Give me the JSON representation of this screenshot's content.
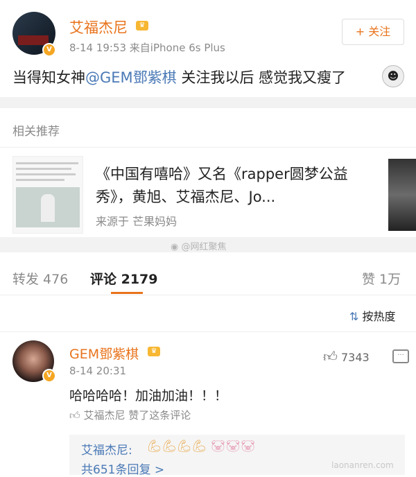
{
  "post": {
    "author": "艾福杰尼",
    "meta": "8-14 19:53  来自iPhone 6s Plus",
    "follow_label": "+ 关注",
    "text_prefix": "当得知女神",
    "mention": "@GEM鄧紫棋",
    "text_suffix": " 关注我以后 感觉我又瘦了"
  },
  "related": {
    "section_title": "相关推荐",
    "card_title": "《中国有嘻哈》又名《rapper圆梦公益秀》，黄旭、艾福杰尼、Jo...",
    "card_source": "来源于 芒果妈妈"
  },
  "watermark": "@网红聚焦",
  "stats": {
    "repost": "转发 476",
    "comment": "评论 2179",
    "like": "赞 1万",
    "sort": "按热度"
  },
  "comment": {
    "author": "GEM鄧紫棋",
    "time": "8-14 20:31",
    "likes": "7343",
    "text": "哈哈哈哈！加油加油！！！",
    "liked_by": "艾福杰尼  赞了这条评论",
    "reply_author": "艾福杰尼:",
    "reply_more": "共651条回复 >"
  },
  "site_watermark": "laonanren.com",
  "colors": {
    "accent": "#e8731c",
    "link": "#4a79b6",
    "divider": "#f2f2f2"
  }
}
